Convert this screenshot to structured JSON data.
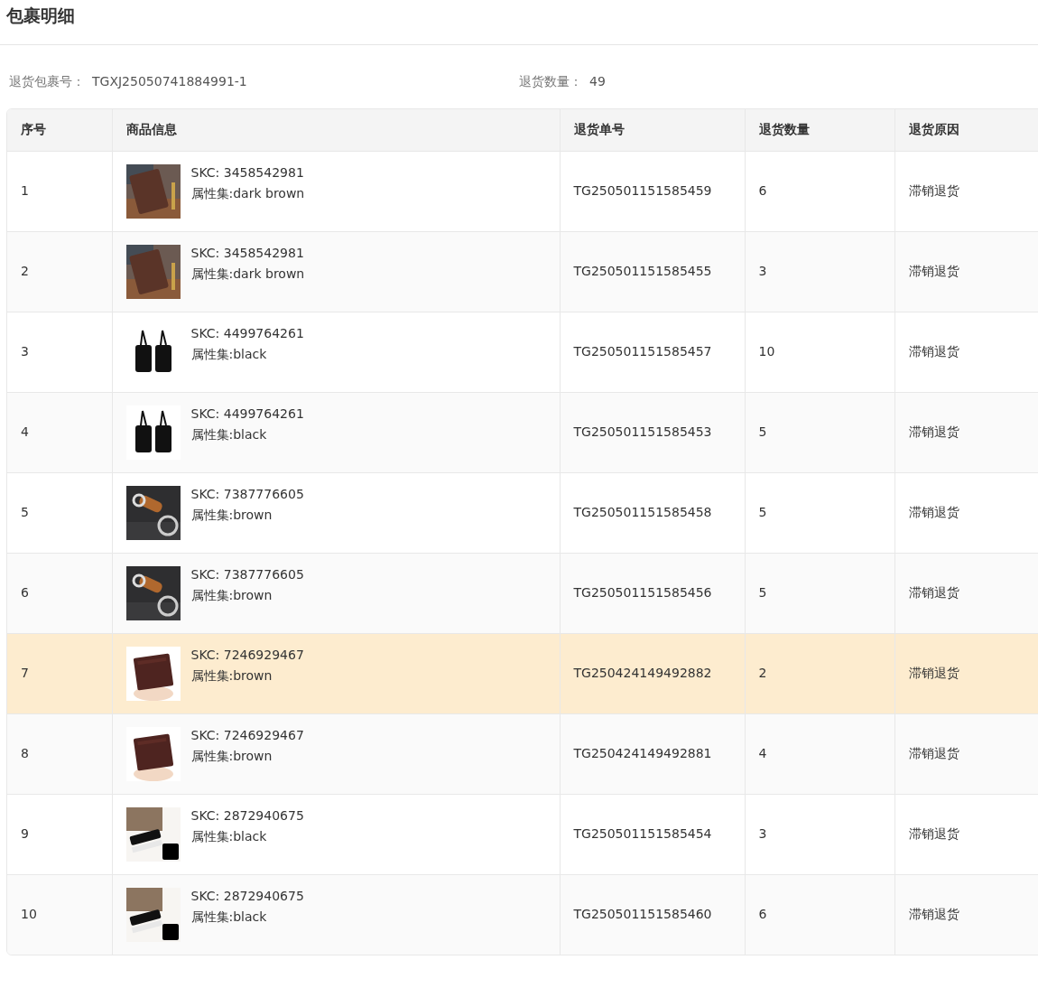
{
  "title": "包裹明细",
  "summary": [
    {
      "label": "退货包裹号：",
      "value": "TGXJ25050741884991-1"
    },
    {
      "label": "退货数量：",
      "value": "49"
    }
  ],
  "table": {
    "columns": [
      "序号",
      "商品信息",
      "退货单号",
      "退货数量",
      "退货原因"
    ],
    "rows": [
      {
        "index": "1",
        "skc": "SKC: 3458542981",
        "attrs": "属性集:dark brown",
        "order": "TG250501151585459",
        "qty": "6",
        "reason": "滞销退货",
        "highlighted": false
      },
      {
        "index": "2",
        "skc": "SKC: 3458542981",
        "attrs": "属性集:dark brown",
        "order": "TG250501151585455",
        "qty": "3",
        "reason": "滞销退货",
        "highlighted": false
      },
      {
        "index": "3",
        "skc": "SKC: 4499764261",
        "attrs": "属性集:black",
        "order": "TG250501151585457",
        "qty": "10",
        "reason": "滞销退货",
        "highlighted": false
      },
      {
        "index": "4",
        "skc": "SKC: 4499764261",
        "attrs": "属性集:black",
        "order": "TG250501151585453",
        "qty": "5",
        "reason": "滞销退货",
        "highlighted": false
      },
      {
        "index": "5",
        "skc": "SKC: 7387776605",
        "attrs": "属性集:brown",
        "order": "TG250501151585458",
        "qty": "5",
        "reason": "滞销退货",
        "highlighted": false
      },
      {
        "index": "6",
        "skc": "SKC: 7387776605",
        "attrs": "属性集:brown",
        "order": "TG250501151585456",
        "qty": "5",
        "reason": "滞销退货",
        "highlighted": false
      },
      {
        "index": "7",
        "skc": "SKC: 7246929467",
        "attrs": "属性集:brown",
        "order": "TG250424149492882",
        "qty": "2",
        "reason": "滞销退货",
        "highlighted": true
      },
      {
        "index": "8",
        "skc": "SKC: 7246929467",
        "attrs": "属性集:brown",
        "order": "TG250424149492881",
        "qty": "4",
        "reason": "滞销退货",
        "highlighted": false
      },
      {
        "index": "9",
        "skc": "SKC: 2872940675",
        "attrs": "属性集:black",
        "order": "TG250501151585454",
        "qty": "3",
        "reason": "滞销退货",
        "highlighted": false
      },
      {
        "index": "10",
        "skc": "SKC: 2872940675",
        "attrs": "属性集:black",
        "order": "TG250501151585460",
        "qty": "6",
        "reason": "滞销退货",
        "highlighted": false
      }
    ]
  }
}
